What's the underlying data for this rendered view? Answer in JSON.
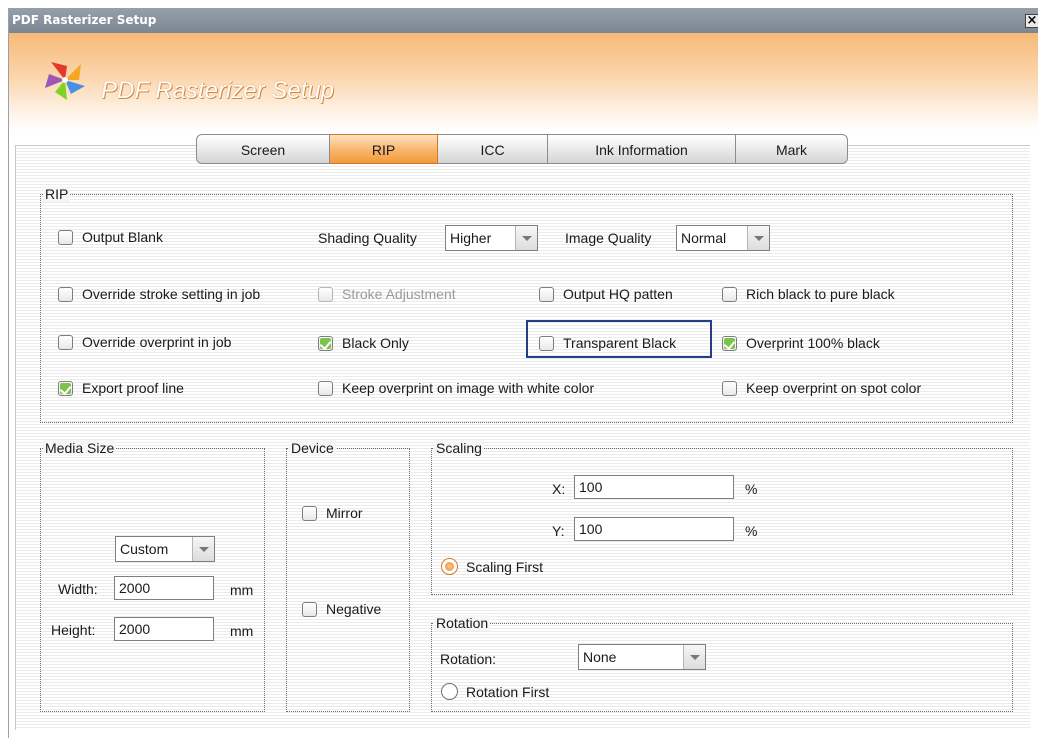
{
  "window": {
    "title": "PDF Rasterizer Setup",
    "close_label": "×"
  },
  "banner": {
    "title": "PDF Rasterizer Setup"
  },
  "tabs": [
    {
      "label": "Screen",
      "active": false
    },
    {
      "label": "RIP",
      "active": true
    },
    {
      "label": "ICC",
      "active": false
    },
    {
      "label": "Ink Information",
      "active": false
    },
    {
      "label": "Mark",
      "active": false
    }
  ],
  "rip": {
    "legend": "RIP",
    "output_blank": {
      "label": "Output Blank",
      "checked": false
    },
    "shading_quality": {
      "label": "Shading Quality",
      "value": "Higher"
    },
    "image_quality": {
      "label": "Image Quality",
      "value": "Normal"
    },
    "override_stroke": {
      "label": "Override stroke setting in job",
      "checked": false
    },
    "stroke_adjustment": {
      "label": "Stroke Adjustment",
      "checked": false,
      "enabled": false
    },
    "output_hq_patten": {
      "label": "Output HQ patten",
      "checked": false
    },
    "rich_black": {
      "label": "Rich black to pure black",
      "checked": false
    },
    "override_overprint": {
      "label": "Override overprint in job",
      "checked": false
    },
    "black_only": {
      "label": "Black Only",
      "checked": true
    },
    "transparent_black": {
      "label": "Transparent Black",
      "checked": false
    },
    "overprint_100_black": {
      "label": "Overprint 100% black",
      "checked": true
    },
    "export_proof_line": {
      "label": "Export proof line",
      "checked": true
    },
    "keep_overprint_white": {
      "label": "Keep overprint on image with white color",
      "checked": false
    },
    "keep_overprint_spot": {
      "label": "Keep overprint on spot color",
      "checked": false
    }
  },
  "media_size": {
    "legend": "Media Size",
    "preset": "Custom",
    "width_label": "Width:",
    "width": "2000",
    "width_unit": "mm",
    "height_label": "Height:",
    "height": "2000",
    "height_unit": "mm"
  },
  "device": {
    "legend": "Device",
    "mirror": {
      "label": "Mirror",
      "checked": false
    },
    "negative": {
      "label": "Negative",
      "checked": false
    }
  },
  "scaling": {
    "legend": "Scaling",
    "x_label": "X:",
    "x": "100",
    "x_unit": "%",
    "y_label": "Y:",
    "y": "100",
    "y_unit": "%",
    "first": {
      "label": "Scaling First",
      "selected": true
    }
  },
  "rotation": {
    "legend": "Rotation",
    "label": "Rotation:",
    "value": "None",
    "first": {
      "label": "Rotation First",
      "selected": false
    }
  },
  "colors": {
    "accent": "#f39a3a",
    "check": "#7cc24f",
    "focus": "#243f86"
  }
}
